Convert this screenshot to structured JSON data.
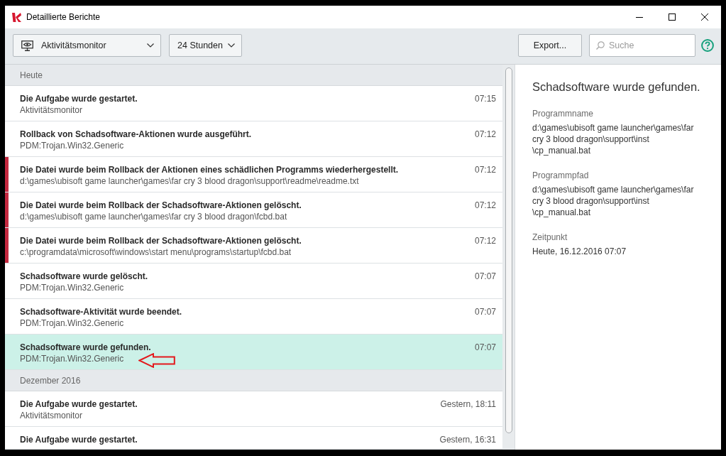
{
  "window": {
    "title": "Detaillierte Berichte"
  },
  "toolbar": {
    "report_dropdown": {
      "value": "Aktivitätsmonitor"
    },
    "period_dropdown": {
      "value": "24 Stunden"
    },
    "export_button": {
      "label": "Export..."
    },
    "search": {
      "placeholder": "Suche"
    }
  },
  "event_list": {
    "groups": [
      {
        "heading": "Heute",
        "events": [
          {
            "title": "Die Aufgabe wurde gestartet.",
            "detail": "Aktivitätsmonitor",
            "time": "07:15",
            "flagged": false,
            "selected": false
          },
          {
            "title": "Rollback von Schadsoftware-Aktionen wurde ausgeführt.",
            "detail": "PDM:Trojan.Win32.Generic",
            "time": "07:12",
            "flagged": false,
            "selected": false
          },
          {
            "title": "Die Datei wurde beim Rollback der Aktionen eines schädlichen Programms wiederhergestellt.",
            "detail": "d:\\games\\ubisoft game launcher\\games\\far cry 3 blood dragon\\support\\readme\\readme.txt",
            "time": "07:12",
            "flagged": true,
            "selected": false
          },
          {
            "title": "Die Datei wurde beim Rollback der Schadsoftware-Aktionen gelöscht.",
            "detail": "d:\\games\\ubisoft game launcher\\games\\far cry 3 blood dragon\\fcbd.bat",
            "time": "07:12",
            "flagged": true,
            "selected": false
          },
          {
            "title": "Die Datei wurde beim Rollback der Schadsoftware-Aktionen gelöscht.",
            "detail": "c:\\programdata\\microsoft\\windows\\start menu\\programs\\startup\\fcbd.bat",
            "time": "07:12",
            "flagged": true,
            "selected": false
          },
          {
            "title": "Schadsoftware wurde gelöscht.",
            "detail": "PDM:Trojan.Win32.Generic",
            "time": "07:07",
            "flagged": false,
            "selected": false
          },
          {
            "title": "Schadsoftware-Aktivität wurde beendet.",
            "detail": "PDM:Trojan.Win32.Generic",
            "time": "07:07",
            "flagged": false,
            "selected": false
          },
          {
            "title": "Schadsoftware wurde gefunden.",
            "detail": "PDM:Trojan.Win32.Generic",
            "time": "07:07",
            "flagged": false,
            "selected": true
          }
        ]
      },
      {
        "heading": "Dezember 2016",
        "events": [
          {
            "title": "Die Aufgabe wurde gestartet.",
            "detail": "Aktivitätsmonitor",
            "time": "Gestern, 18:11",
            "flagged": false,
            "selected": false
          },
          {
            "title": "Die Aufgabe wurde gestartet.",
            "time": "Gestern, 16:31",
            "flagged": false,
            "selected": false
          }
        ]
      }
    ]
  },
  "details": {
    "title": "Schadsoftware wurde gefunden.",
    "fields": [
      {
        "label": "Programmname",
        "lines": [
          "d:\\games\\ubisoft game launcher\\games\\far",
          "cry 3 blood dragon\\support\\inst",
          "\\cp_manual.bat"
        ]
      },
      {
        "label": "Programmpfad",
        "lines": [
          "d:\\games\\ubisoft game launcher\\games\\far",
          "cry 3 blood dragon\\support\\inst",
          "\\cp_manual.bat"
        ]
      },
      {
        "label": "Zeitpunkt",
        "lines": [
          "Heute, 16.12.2016 07:07"
        ]
      }
    ]
  }
}
